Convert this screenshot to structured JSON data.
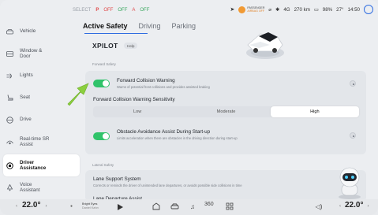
{
  "status_bar": {
    "left_indicators": [
      "SELECT",
      "P",
      "OFF",
      "OFF",
      "A",
      "OFF"
    ],
    "passenger_airbag_line1": "PASSENGER",
    "passenger_airbag_line2": "AIRBAG OFF",
    "signal": "4G",
    "range": "270 km",
    "battery": "98%",
    "temperature": "27°",
    "time": "14:50"
  },
  "sidebar": {
    "items": [
      {
        "label": "Vehicle",
        "icon": "car-icon"
      },
      {
        "label": "Window & Door",
        "icon": "window-icon"
      },
      {
        "label": "Lights",
        "icon": "light-icon"
      },
      {
        "label": "Seat",
        "icon": "seat-icon"
      },
      {
        "label": "Drive",
        "icon": "steering-icon"
      },
      {
        "label": "Real-time SR Assist",
        "icon": "sr-assist-icon"
      },
      {
        "label": "Driver Assistance",
        "icon": "driver-assist-icon"
      },
      {
        "label": "Voice Assistant",
        "icon": "voice-icon"
      }
    ],
    "active_index": 6
  },
  "tabs": [
    "Active Safety",
    "Driving",
    "Parking"
  ],
  "header": {
    "title": "XPILOT",
    "help": "Help"
  },
  "forward_safety": {
    "section_label": "Forward Safety",
    "fcw_title": "Forward Collision Warning",
    "fcw_desc": "Warns of potential front collisions and provides assisted braking",
    "sensitivity_label": "Forward Collision Warning Sensitivity",
    "sensitivity_options": [
      "Low",
      "Moderate",
      "High"
    ],
    "sensitivity_selected": "High",
    "oaa_title": "Obstacle Avoidance Assist During Start-up",
    "oaa_desc": "Limits acceleration when there are obstacles in the driving direction during start-up"
  },
  "lateral_safety": {
    "section_label": "Lateral Safety",
    "lss_title": "Lane Support System",
    "lss_desc": "Corrects or reminds the driver of unintended lane departures, or avoids possible side collisions in time",
    "ldp_title": "Lane Departure Assist"
  },
  "dock": {
    "left_temp": "22.0°",
    "right_temp": "22.0°",
    "song_title": "Bright Eyes",
    "song_artist": "Daniel Kahn",
    "view_360": "360"
  },
  "colors": {
    "accent": "#2f6de1",
    "toggle_on": "#30c36a",
    "arrow": "#8bcf3f"
  }
}
